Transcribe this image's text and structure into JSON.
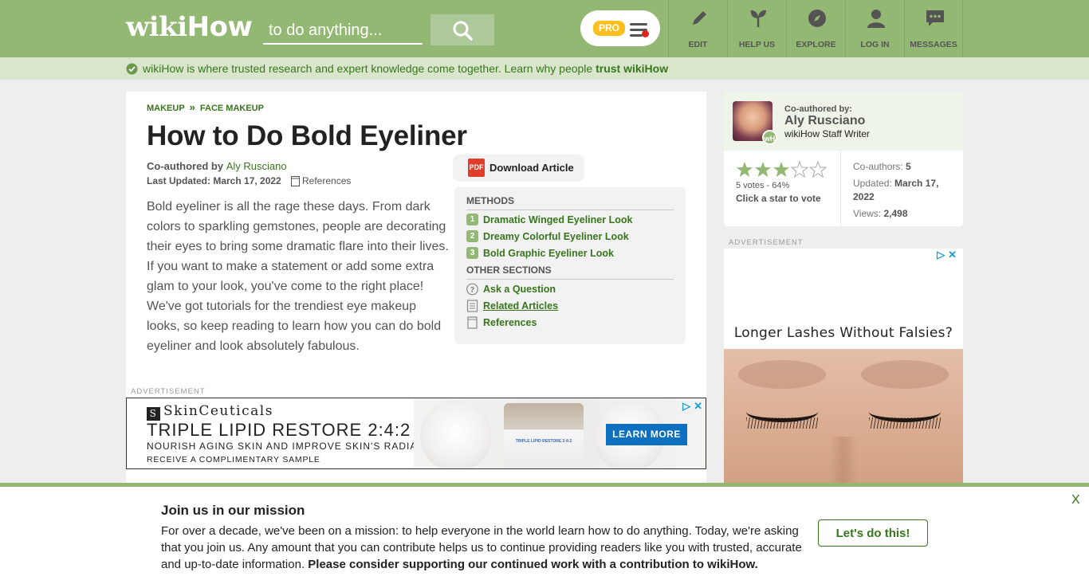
{
  "header": {
    "logo_wiki": "wiki",
    "logo_how": "How",
    "search_placeholder": "to do anything...",
    "pro_badge": "PRO",
    "nav": [
      {
        "label": "EDIT",
        "icon": "pencil-icon"
      },
      {
        "label": "HELP US",
        "icon": "sprout-icon"
      },
      {
        "label": "EXPLORE",
        "icon": "compass-icon"
      },
      {
        "label": "LOG IN",
        "icon": "user-icon"
      },
      {
        "label": "MESSAGES",
        "icon": "chat-bubble-icon"
      }
    ]
  },
  "trust_bar": {
    "text": "wikiHow is where trusted research and expert knowledge come together. Learn why people",
    "link": "trust wikiHow"
  },
  "article": {
    "breadcrumb": [
      "MAKEUP",
      "FACE MAKEUP"
    ],
    "breadcrumb_sep": "»",
    "title": "How to Do Bold Eyeliner",
    "coauthored_label": "Co-authored by",
    "author": "Aly Rusciano",
    "last_updated": "Last Updated: March 17, 2022",
    "references_label": "References",
    "intro": "Bold eyeliner is all the rage these days. From dark colors to sparkling gemstones, people are decorating their eyes to bring some dramatic flare into their lives. If you want to make a statement or add some extra glam to your look, you've come to the right place! We've got tutorials for the trendiest eye makeup looks, so keep reading to learn how you can do bold eyeliner and look absolutely fabulous.",
    "download_label": "Download Article",
    "pdf_label": "PDF",
    "toc": {
      "methods_heading": "METHODS",
      "methods": [
        {
          "num": "1",
          "label": "Dramatic Winged Eyeliner Look"
        },
        {
          "num": "2",
          "label": "Dreamy Colorful Eyeliner Look"
        },
        {
          "num": "3",
          "label": "Bold Graphic Eyeliner Look"
        }
      ],
      "other_heading": "OTHER SECTIONS",
      "other": [
        {
          "label": "Ask a Question",
          "icon": "question-circle-icon"
        },
        {
          "label": "Related Articles",
          "icon": "document-icon"
        },
        {
          "label": "References",
          "icon": "bookmark-icon"
        }
      ]
    }
  },
  "ads": {
    "label": "ADVERTISEMENT",
    "banner": {
      "brand_mark": "S",
      "brand": "SkinCeuticals",
      "headline": "TRIPLE LIPID RESTORE 2:4:2",
      "sub1": "NOURISH AGING SKIN AND IMPROVE SKIN'S RADIANCE",
      "sub2": "RECEIVE A COMPLIMENTARY SAMPLE",
      "cta": "LEARN MORE",
      "jar_text": "TRIPLE LIPID RESTORE 2:4:2"
    },
    "side": {
      "headline": "Longer Lashes Without Falsies?"
    },
    "choices_play": "▷",
    "choices_close": "✕"
  },
  "sidebar": {
    "coauthored_by": "Co-authored by:",
    "author_name": "Aly Rusciano",
    "author_role": "wikiHow Staff Writer",
    "avatar_badge": "wH",
    "rating": {
      "filled": 3,
      "total": 5
    },
    "votes": "5 votes - 64%",
    "click_to_vote": "Click a star to vote",
    "coauthors_label": "Co-authors:",
    "coauthors_value": "5",
    "updated_label": "Updated:",
    "updated_value": "March 17, 2022",
    "views_label": "Views:",
    "views_value": "2,498"
  },
  "mission": {
    "title": "Join us in our mission",
    "body": "For over a decade, we've been on a mission: to help everyone in the world learn how to do anything. Today, we're asking that you join us. Any amount that you can contribute helps us to continue providing readers like you with trusted, accurate and up-to-date information.",
    "body_bold": "Please consider supporting our continued work with a contribution to wikiHow.",
    "button": "Let's do this!",
    "close": "X"
  },
  "colors": {
    "brand_green": "#93b874",
    "link_green": "#38761d",
    "trust_bg": "#d9e6cc",
    "pro_yellow": "#fcbf1e",
    "notification_red": "#e0251c"
  }
}
